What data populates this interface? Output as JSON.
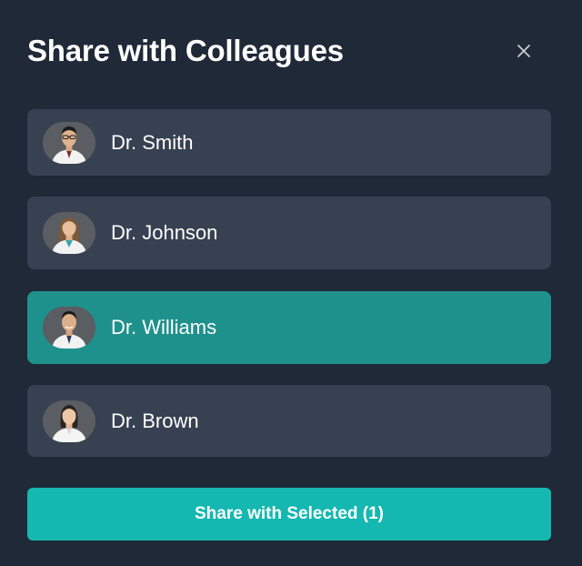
{
  "dialog": {
    "title": "Share with Colleagues",
    "close_icon": "close-icon"
  },
  "colleagues": [
    {
      "name": "Dr. Smith",
      "selected": false,
      "avatar": "doctor-male-glasses-avatar"
    },
    {
      "name": "Dr. Johnson",
      "selected": false,
      "avatar": "doctor-female-long-hair-avatar"
    },
    {
      "name": "Dr. Williams",
      "selected": true,
      "avatar": "doctor-male-avatar"
    },
    {
      "name": "Dr. Brown",
      "selected": false,
      "avatar": "doctor-female-avatar"
    }
  ],
  "actions": {
    "share_label": "Share with Selected (1)"
  },
  "colors": {
    "background": "#1f2937",
    "item": "#374151",
    "item_selected": "#1f918c",
    "primary_button": "#14b8b0"
  }
}
